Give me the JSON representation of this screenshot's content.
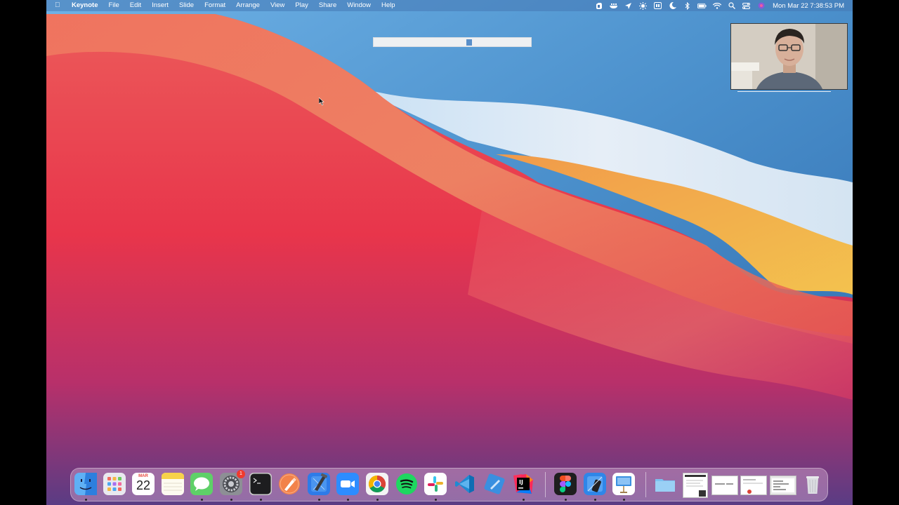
{
  "menubar": {
    "app_name": "Keynote",
    "menus": [
      "File",
      "Edit",
      "Insert",
      "Slide",
      "Format",
      "Arrange",
      "View",
      "Play",
      "Share",
      "Window",
      "Help"
    ],
    "clock": "Mon Mar 22  7:38:53 PM",
    "status_icons": [
      "evernote-icon",
      "docker-icon",
      "notification-icon",
      "brightness-icon",
      "bear-icon",
      "do-not-disturb-icon",
      "bluetooth-icon",
      "battery-icon",
      "wifi-icon",
      "spotlight-icon",
      "control-center-icon",
      "siri-icon"
    ]
  },
  "dock": {
    "calendar_month": "MAR",
    "calendar_day": "22",
    "settings_badge": "1",
    "intellij_label": "IJ",
    "apps": [
      "finder",
      "launchpad",
      "calendar",
      "notes",
      "messages",
      "system-preferences",
      "terminal",
      "sketch",
      "xcode",
      "zoom",
      "chrome",
      "spotify",
      "slack",
      "vscode",
      "notability",
      "intellij",
      "figma",
      "simulator",
      "keynote",
      "downloads-folder"
    ]
  },
  "progress": {
    "value": 0.61
  },
  "colors": {
    "menubar_bg": "#4678b4",
    "wallpaper_blue": "#3c82c4",
    "wallpaper_red": "#e8384b",
    "wallpaper_orange": "#f0905a",
    "wallpaper_yellow": "#f2b54c"
  }
}
